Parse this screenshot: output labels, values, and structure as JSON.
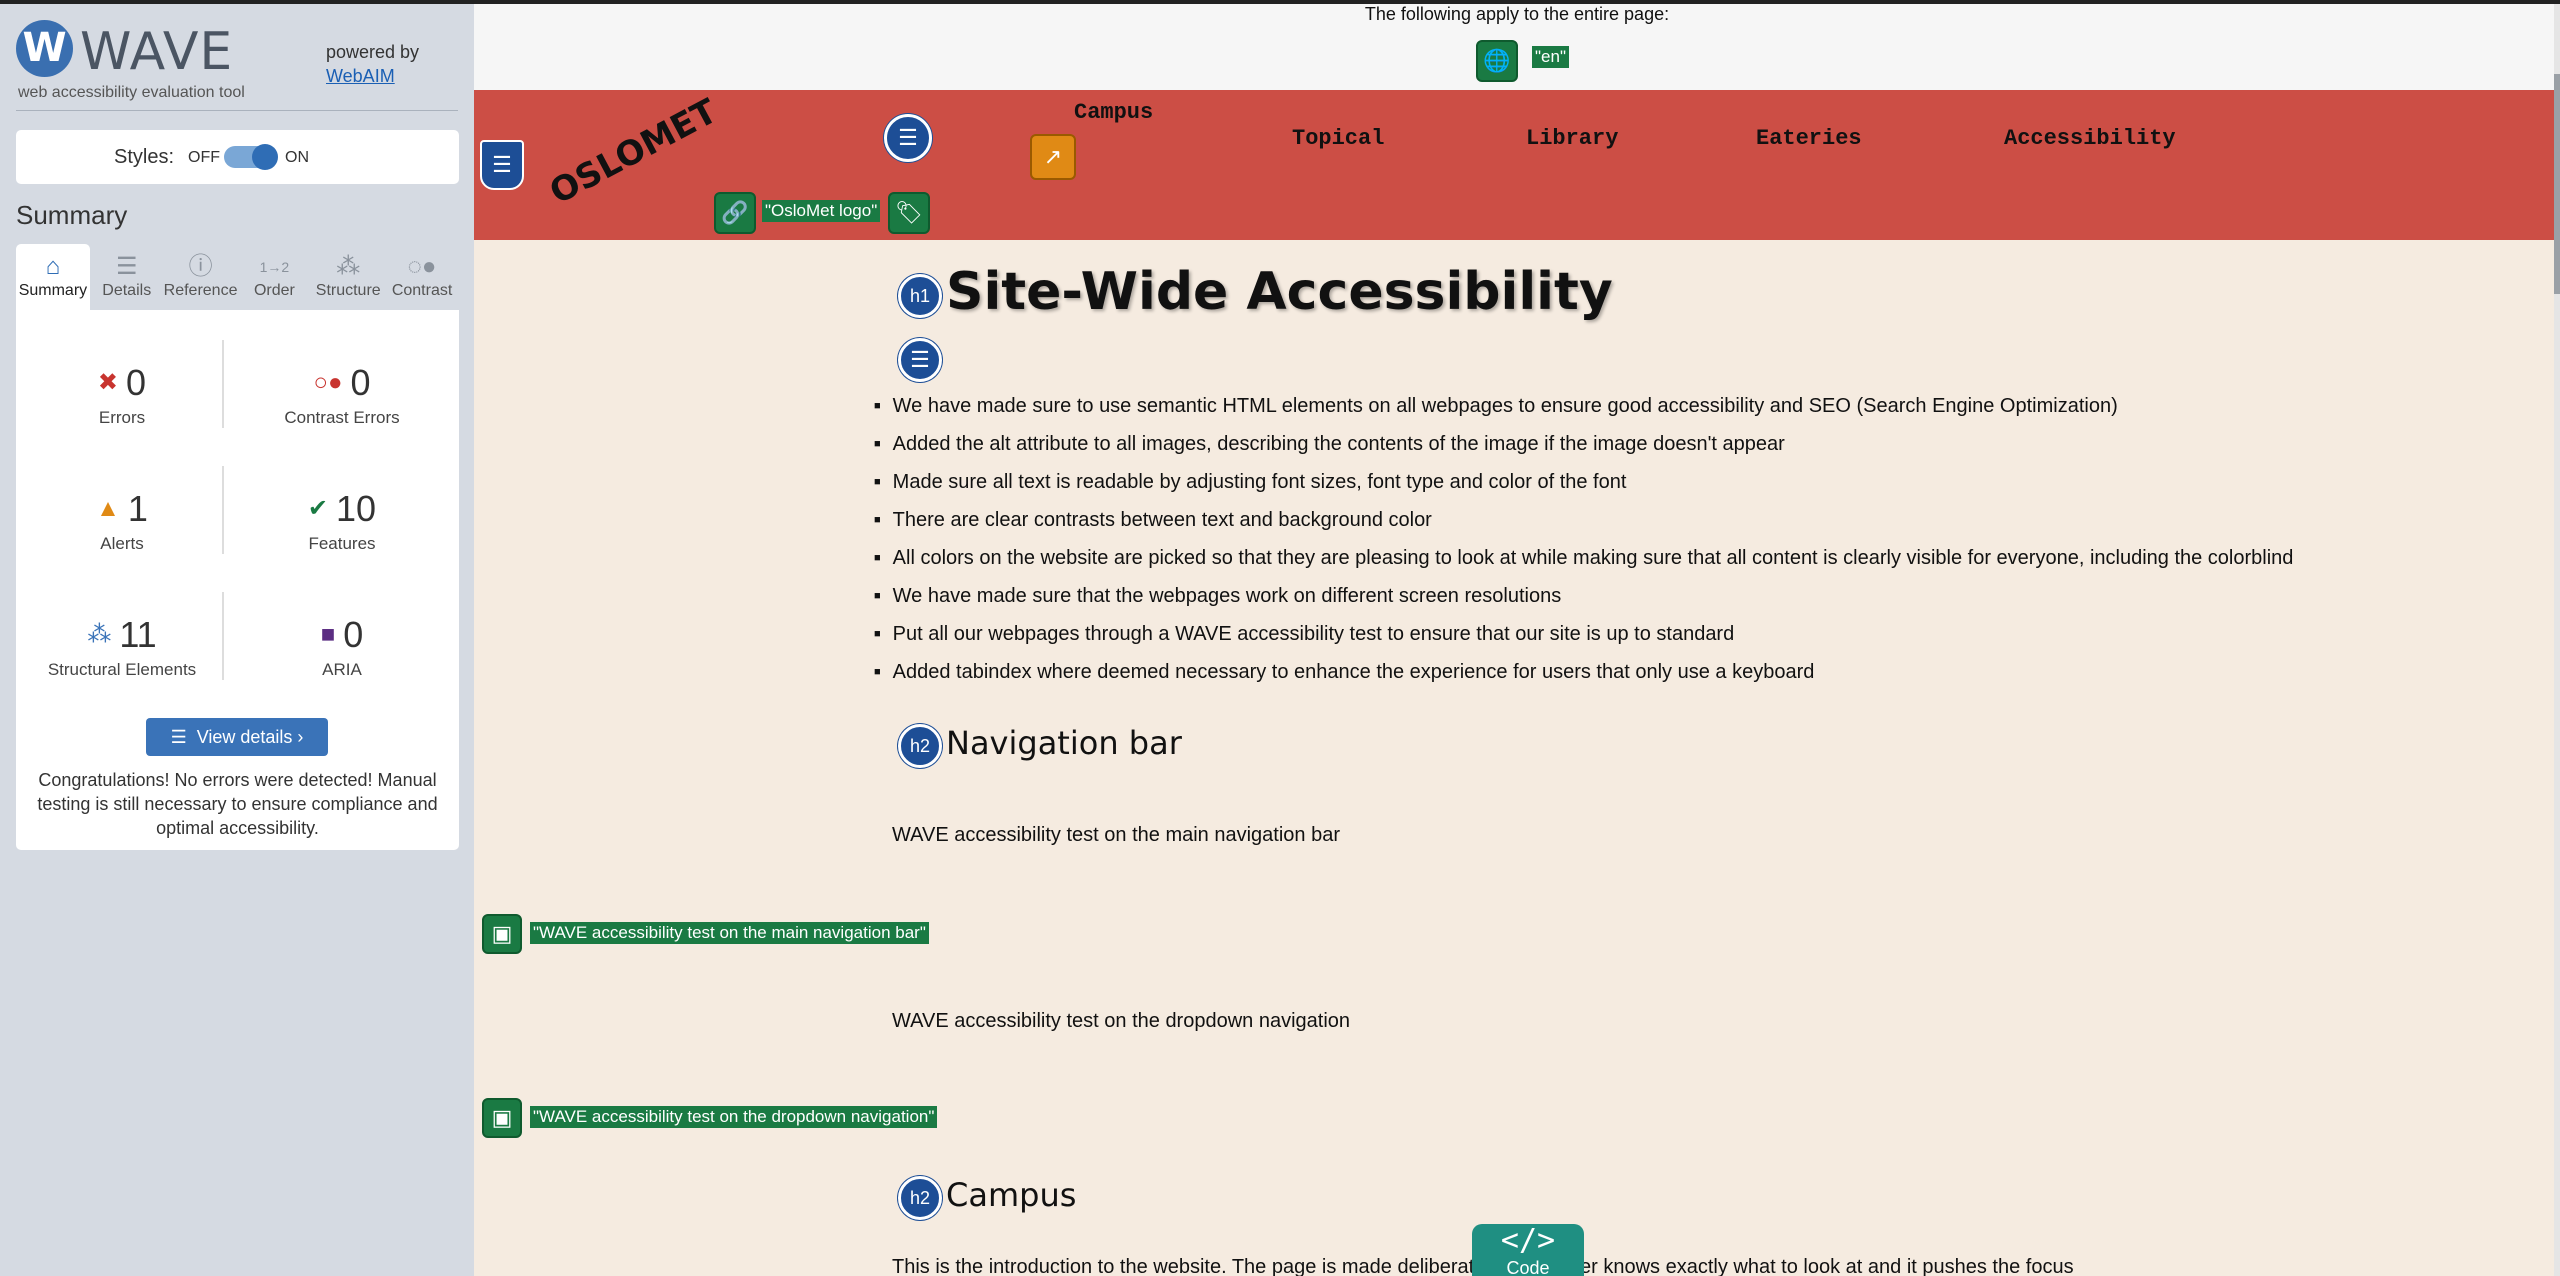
{
  "sidebar": {
    "logo_text": "WAVE",
    "logo_letter": "W",
    "tagline": "web accessibility evaluation tool",
    "powered_by": "powered by",
    "webaim_link": "WebAIM",
    "styles": {
      "label": "Styles:",
      "off": "OFF",
      "on": "ON",
      "state": "on"
    },
    "summary_title": "Summary",
    "tabs": [
      {
        "label": "Summary",
        "icon": "home-icon",
        "active": true
      },
      {
        "label": "Details",
        "icon": "list-icon",
        "active": false
      },
      {
        "label": "Reference",
        "icon": "info-icon",
        "active": false
      },
      {
        "label": "Order",
        "icon": "order-icon",
        "active": false
      },
      {
        "label": "Structure",
        "icon": "structure-icon",
        "active": false
      },
      {
        "label": "Contrast",
        "icon": "contrast-icon",
        "active": false
      }
    ],
    "stats": {
      "errors": {
        "count": "0",
        "label": "Errors"
      },
      "contrast": {
        "count": "0",
        "label": "Contrast Errors"
      },
      "alerts": {
        "count": "1",
        "label": "Alerts"
      },
      "features": {
        "count": "10",
        "label": "Features"
      },
      "structural": {
        "count": "11",
        "label": "Structural Elements"
      },
      "aria": {
        "count": "0",
        "label": "ARIA"
      }
    },
    "view_details": "View details ›",
    "congrats": "Congratulations! No errors were detected! Manual testing is still necessary to ensure compliance and optimal accessibility."
  },
  "page": {
    "banner_text": "The following apply to the entire page:",
    "lang_label": "\"en\"",
    "logo_text": "OSLOMET",
    "logo_alt_label": "\"OsloMet logo\"",
    "nav": {
      "campus": "Campus",
      "topical": "Topical",
      "library": "Library",
      "eateries": "Eateries",
      "accessibility": "Accessibility"
    },
    "h1": "Site-Wide Accessibility",
    "h1_marker": "h1",
    "h2_marker": "h2",
    "bullets": [
      "We have made sure to use semantic HTML elements on all webpages to ensure good accessibility and SEO (Search Engine Optimization)",
      "Added the alt attribute to all images, describing the contents of the image if the image doesn't appear",
      "Made sure all text is readable by adjusting font sizes, font type and color of the font",
      "There are clear contrasts between text and background color",
      "All colors on the website are picked so that they are pleasing to look at while making sure that all content is clearly visible for everyone, including the colorblind",
      "We have made sure that the webpages work on different screen resolutions",
      "Put all our webpages through a WAVE accessibility test to ensure that our site is up to standard",
      "Added tabindex where deemed necessary to enhance the experience for users that only use a keyboard"
    ],
    "h2_nav": "Navigation bar",
    "para_nav": "WAVE accessibility test on the main navigation bar",
    "alt_nav": "\"WAVE accessibility test on the main navigation bar\"",
    "para_dropdown": "WAVE accessibility test on the dropdown navigation",
    "alt_dropdown": "\"WAVE accessibility test on the dropdown navigation\"",
    "h2_campus": "Campus",
    "para_campus": "This is the introduction to the website. The page is made deliberat",
    "para_campus_end": "e user knows exactly what to look at and it pushes the focus",
    "code_button": {
      "symbol": "</>",
      "label": "Code"
    }
  },
  "colors": {
    "sidebar_bg": "#d5dae2",
    "page_bg": "#f5ebe0",
    "navbar_bg": "#cc4e45",
    "wave_green": "#1a7a43",
    "wave_blue": "#1d4e96",
    "code_teal": "#1f8f82"
  }
}
